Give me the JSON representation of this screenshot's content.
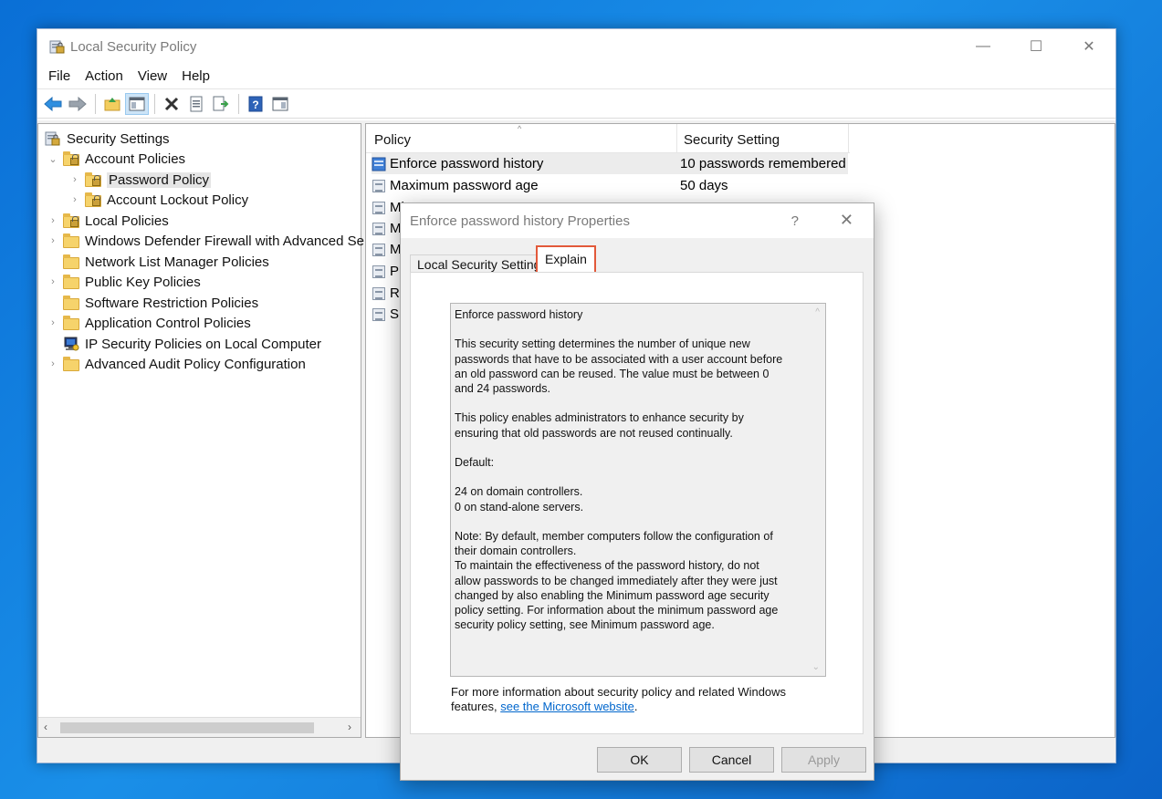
{
  "window": {
    "title": "Local Security Policy",
    "controls": {
      "minimize": "—",
      "maximize": "☐",
      "close": "✕"
    }
  },
  "menubar": [
    "File",
    "Action",
    "View",
    "Help"
  ],
  "toolbar": {
    "icons": [
      "back-arrow-icon",
      "forward-arrow-icon",
      "up-folder-icon",
      "show-hide-tree-icon",
      "delete-icon",
      "properties-icon",
      "export-list-icon",
      "help-icon",
      "action-pane-icon"
    ]
  },
  "tree": {
    "root": "Security Settings",
    "items": [
      {
        "label": "Account Policies",
        "expander": "⌄"
      },
      {
        "label": "Password Policy",
        "expander": "›"
      },
      {
        "label": "Account Lockout Policy",
        "expander": "›"
      },
      {
        "label": "Local Policies",
        "expander": "›"
      },
      {
        "label": "Windows Defender Firewall with Advanced Se",
        "expander": "›"
      },
      {
        "label": "Network List Manager Policies",
        "expander": ""
      },
      {
        "label": "Public Key Policies",
        "expander": "›"
      },
      {
        "label": "Software Restriction Policies",
        "expander": ""
      },
      {
        "label": "Application Control Policies",
        "expander": "›"
      },
      {
        "label": "IP Security Policies on Local Computer",
        "expander": ""
      },
      {
        "label": "Advanced Audit Policy Configuration",
        "expander": "›"
      }
    ],
    "scroll_left": "‹",
    "scroll_right": "›"
  },
  "list": {
    "columns": [
      "Policy",
      "Security Setting"
    ],
    "sort_indicator": "^",
    "rows": [
      {
        "policy": "Enforce password history",
        "setting": "10 passwords remembered"
      },
      {
        "policy": "Maximum password age",
        "setting": "50 days"
      },
      {
        "policy": "Mi",
        "setting": ""
      },
      {
        "policy": "M",
        "setting": ""
      },
      {
        "policy": "M",
        "setting": ""
      },
      {
        "policy": "P",
        "setting": ""
      },
      {
        "policy": "R",
        "setting": ""
      },
      {
        "policy": "S",
        "setting": ""
      }
    ]
  },
  "dialog": {
    "title": "Enforce password history Properties",
    "help": "?",
    "close": "✕",
    "tabs": [
      "Local Security Setting",
      "Explain"
    ],
    "explain": {
      "heading": "Enforce password history",
      "p1": "This security setting determines the number of unique new\npasswords that have to be associated with a user account before\nan old password can be reused. The value must be between 0\nand 24 passwords.",
      "p2": "This policy enables administrators to enhance security by\nensuring that old passwords are not reused continually.",
      "p3": "Default:",
      "p4": "24 on domain controllers.\n0 on stand-alone servers.",
      "p5": "Note: By default, member computers follow the configuration of\ntheir domain controllers.",
      "p6": "To maintain the effectiveness of the password history, do not\nallow passwords to be changed immediately after they were just\nchanged by also enabling the Minimum password age security\npolicy setting. For information about the minimum password age\nsecurity policy setting, see Minimum password age.",
      "scroll_up": "^",
      "scroll_down": "⌄"
    },
    "more_info": "For more information about security policy and related Windows features,",
    "link": "see the Microsoft website",
    "link_suffix": ".",
    "buttons": {
      "ok": "OK",
      "cancel": "Cancel",
      "apply": "Apply"
    }
  },
  "colors": {
    "accent_highlight": "#e2593a",
    "link": "#0066cc",
    "desktop": "#0a6fd6"
  }
}
